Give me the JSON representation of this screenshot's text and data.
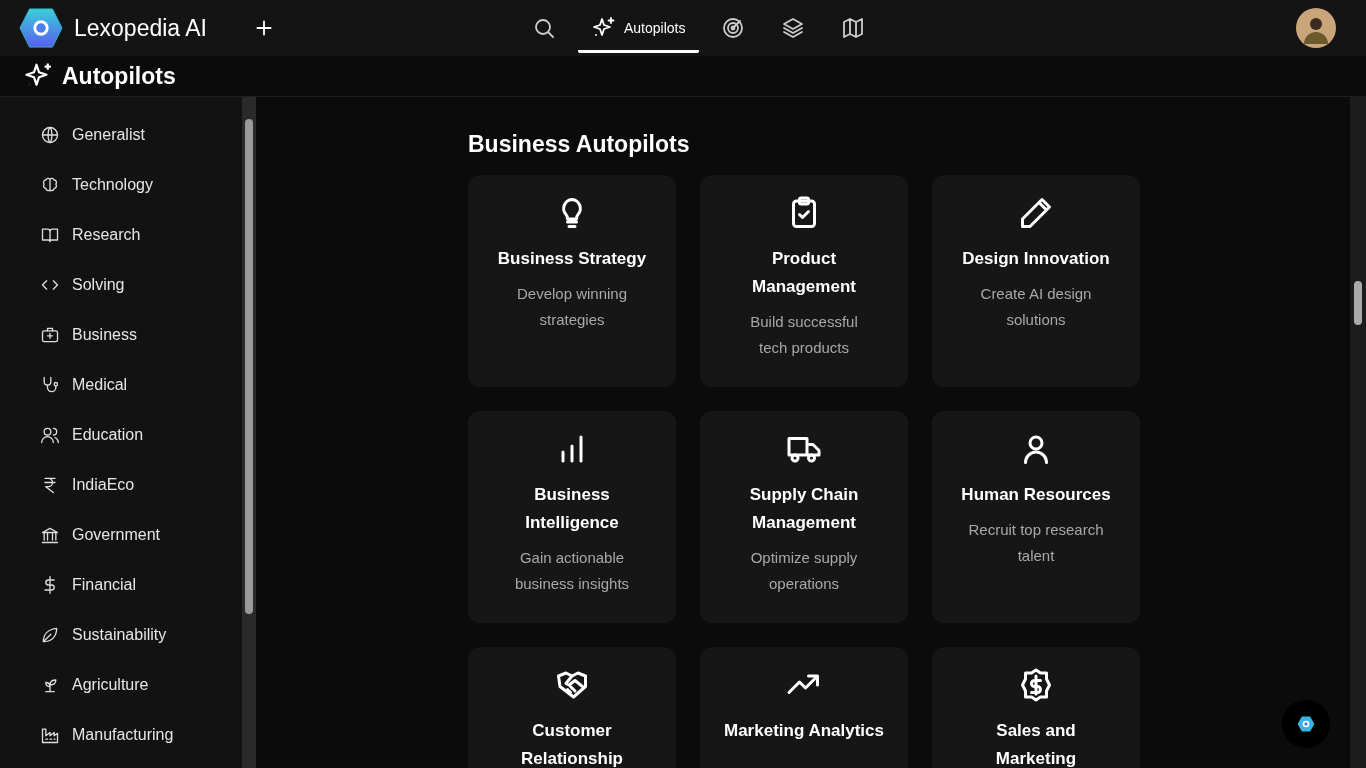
{
  "app": {
    "name": "Lexopedia AI"
  },
  "nav": [
    {
      "selected": false
    },
    {
      "label": "Autopilots",
      "selected": true
    },
    {
      "selected": false
    },
    {
      "selected": false
    },
    {
      "selected": false
    }
  ],
  "page_title": "Autopilots",
  "sidebar": {
    "items": [
      {
        "label": "Generalist"
      },
      {
        "label": "Technology"
      },
      {
        "label": "Research"
      },
      {
        "label": "Solving"
      },
      {
        "label": "Business"
      },
      {
        "label": "Medical"
      },
      {
        "label": "Education"
      },
      {
        "label": "IndiaEco"
      },
      {
        "label": "Government"
      },
      {
        "label": "Financial"
      },
      {
        "label": "Sustainability"
      },
      {
        "label": "Agriculture"
      },
      {
        "label": "Manufacturing"
      }
    ]
  },
  "section": {
    "title": "Business Autopilots",
    "cards": [
      {
        "title": "Business Strategy",
        "description": "Develop winning strategies"
      },
      {
        "title": "Product Management",
        "description": "Build successful tech products"
      },
      {
        "title": "Design Innovation",
        "description": "Create AI design solutions"
      },
      {
        "title": "Business Intelligence",
        "description": "Gain actionable business insights"
      },
      {
        "title": "Supply Chain Management",
        "description": "Optimize supply operations"
      },
      {
        "title": "Human Resources",
        "description": "Recruit top research talent"
      },
      {
        "title": "Customer Relationship"
      },
      {
        "title": "Marketing Analytics"
      },
      {
        "title": "Sales and Marketing"
      }
    ]
  }
}
